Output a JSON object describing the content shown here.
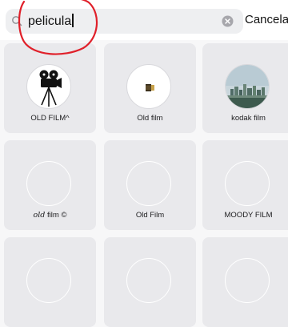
{
  "search": {
    "value": "pelicula",
    "cancel_label": "Cancelar"
  },
  "results": [
    {
      "label": "OLD FILM^",
      "icon": "film-camera-icon",
      "avatar": "camera"
    },
    {
      "label": "Old film",
      "icon": "film-roll-icon",
      "avatar": "film"
    },
    {
      "label": "kodak film",
      "icon": "city-skyline-icon",
      "avatar": "city"
    },
    {
      "label_prefix": "old",
      "label": "film ©",
      "icon": "",
      "avatar": "empty"
    },
    {
      "label": "Old Film",
      "icon": "",
      "avatar": "empty"
    },
    {
      "label": "MOODY FILM",
      "icon": "",
      "avatar": "empty"
    }
  ],
  "colors": {
    "annotation": "#e0202a",
    "card_background": "#e9e9ec",
    "search_background": "#eeeff1"
  }
}
